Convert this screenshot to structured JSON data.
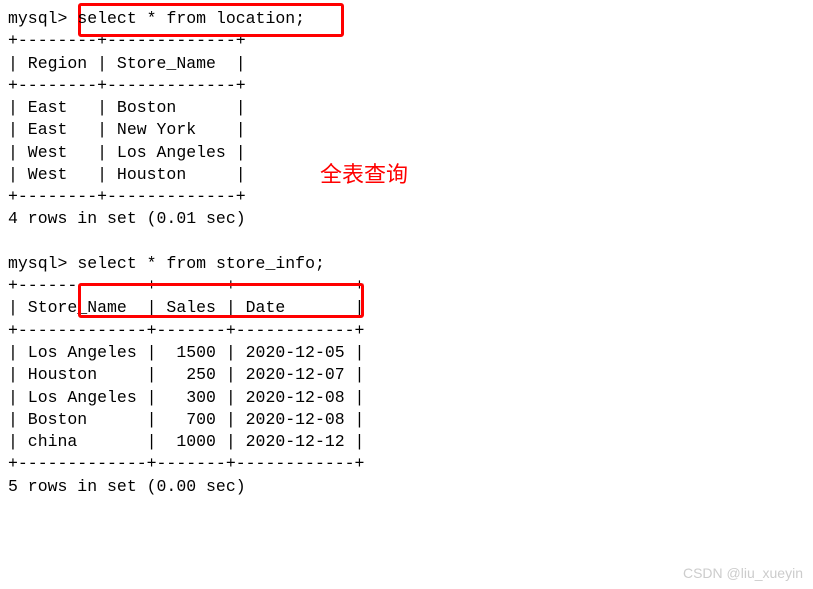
{
  "prompt": "mysql>",
  "query1": {
    "sql": "select * from location;",
    "border": "+--------+-------------+",
    "header": "| Region | Store_Name  |",
    "rows": [
      "| East   | Boston      |",
      "| East   | New York    |",
      "| West   | Los Angeles |",
      "| West   | Houston     |"
    ],
    "footer": "4 rows in set (0.01 sec)"
  },
  "query2": {
    "sql": "select * from store_info;",
    "border": "+-------------+-------+------------+",
    "header": "| Store_Name  | Sales | Date       |",
    "rows": [
      "| Los Angeles |  1500 | 2020-12-05 |",
      "| Houston     |   250 | 2020-12-07 |",
      "| Los Angeles |   300 | 2020-12-08 |",
      "| Boston      |   700 | 2020-12-08 |",
      "| china       |  1000 | 2020-12-12 |"
    ],
    "footer": "5 rows in set (0.00 sec)"
  },
  "annotation": "全表查询",
  "watermark": "CSDN @liu_xueyin",
  "chart_data": {
    "type": "table",
    "tables": [
      {
        "name": "location",
        "columns": [
          "Region",
          "Store_Name"
        ],
        "rows": [
          [
            "East",
            "Boston"
          ],
          [
            "East",
            "New York"
          ],
          [
            "West",
            "Los Angeles"
          ],
          [
            "West",
            "Houston"
          ]
        ]
      },
      {
        "name": "store_info",
        "columns": [
          "Store_Name",
          "Sales",
          "Date"
        ],
        "rows": [
          [
            "Los Angeles",
            1500,
            "2020-12-05"
          ],
          [
            "Houston",
            250,
            "2020-12-07"
          ],
          [
            "Los Angeles",
            300,
            "2020-12-08"
          ],
          [
            "Boston",
            700,
            "2020-12-08"
          ],
          [
            "china",
            1000,
            "2020-12-12"
          ]
        ]
      }
    ]
  }
}
